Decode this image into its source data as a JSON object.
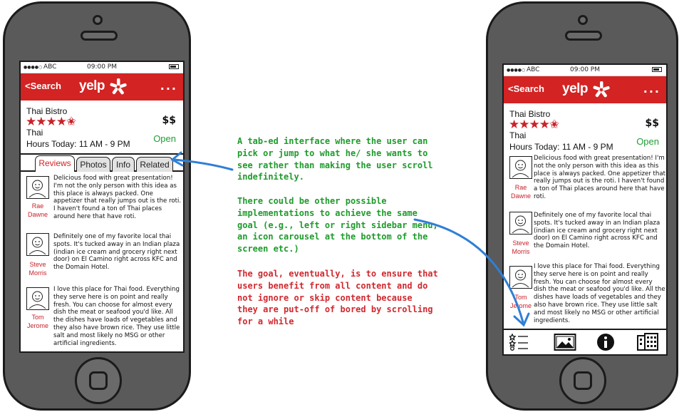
{
  "status": {
    "signal": "●●●●○",
    "carrier": "ABC",
    "time": "09:00 PM"
  },
  "nav": {
    "back_label": "<Search",
    "brand": "yelp",
    "more_label": "..."
  },
  "business": {
    "name": "Thai Bistro",
    "stars": "★★★★✬",
    "rating": 4.5,
    "category": "Thai",
    "hours": "Hours Today: 11 AM - 9 PM",
    "price": "$$",
    "status": "Open"
  },
  "tabs": [
    "Reviews",
    "Photos",
    "Info",
    "Related"
  ],
  "reviews": [
    {
      "first": "Rae",
      "last": "Dawne",
      "text": "Delicious food with great presentation! I'm not the only person with this idea as this place is always packed. One appetizer that really jumps out is the roti. I haven't found a ton of Thai places around here that have roti."
    },
    {
      "first": "Steve",
      "last": "Morris",
      "text": "Definitely one of my favorite local thai spots. It's tucked away in an Indian plaza (indian ice cream and grocery right next door) on El Camino right across KFC and the Domain Hotel."
    },
    {
      "first": "Tom",
      "last": "Jerome",
      "text": "I love this place for Thai food. Everything they serve here is on point and really fresh. You can choose for almost every dish the meat or seafood you'd like. All the dishes have loads of vegetables and they also have brown rice. They use little salt and most likely no MSG or other artificial ingredients."
    }
  ],
  "toolbar": [
    "reviews-list-icon",
    "photos-icon",
    "info-icon",
    "related-icon"
  ],
  "annotations": {
    "green1": "A tab-ed interface where the user can\npick or jump to what he/ she wants to\nsee rather than making the user scroll\nindefinitely.",
    "green2": "There could be other possible\nimplementations to achieve the same\ngoal (e.g., left or right sidebar menu,\nan icon carousel at the bottom of the\nscreen etc.)",
    "red": "The goal, eventually, is to ensure that\nusers benefit from all content and do\nnot ignore or skip content because\nthey are put-off of bored by scrolling\nfor a while"
  },
  "colors": {
    "brand_red": "#d32323",
    "open_green": "#1e9e35",
    "note_green": "#1f9b2c",
    "note_red": "#d0282e",
    "arrow_blue": "#2f7fd6"
  }
}
